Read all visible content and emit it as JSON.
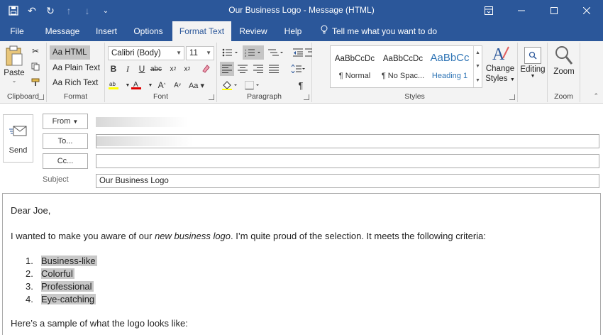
{
  "window": {
    "title": "Our Business Logo  -  Message (HTML)"
  },
  "tabs": [
    {
      "label": "File"
    },
    {
      "label": "Message"
    },
    {
      "label": "Insert"
    },
    {
      "label": "Options"
    },
    {
      "label": "Format Text"
    },
    {
      "label": "Review"
    },
    {
      "label": "Help"
    }
  ],
  "tell_me": "Tell me what you want to do",
  "ribbon": {
    "clipboard": {
      "paste": "Paste",
      "label": "Clipboard"
    },
    "format": {
      "html": "Aa HTML",
      "plain": "Aa Plain Text",
      "rich": "Aa Rich Text",
      "label": "Format"
    },
    "font": {
      "name": "Calibri (Body)",
      "size": "11",
      "label": "Font"
    },
    "paragraph": {
      "label": "Paragraph"
    },
    "styles": {
      "items": [
        {
          "sample": "AaBbCcDc",
          "name": "¶ Normal"
        },
        {
          "sample": "AaBbCcDc",
          "name": "¶ No Spac..."
        },
        {
          "sample": "AaBbCc",
          "name": "Heading 1"
        }
      ],
      "change_line1": "Change",
      "change_line2": "Styles",
      "label": "Styles"
    },
    "editing": "Editing",
    "zoom": {
      "button": "Zoom",
      "label": "Zoom"
    }
  },
  "compose": {
    "send": "Send",
    "from": "From",
    "to": "To...",
    "cc": "Cc...",
    "subject_label": "Subject",
    "subject_value": "Our Business Logo"
  },
  "message": {
    "greeting": "Dear Joe,",
    "intro_before": "I wanted to make you aware of our ",
    "intro_em": "new business logo",
    "intro_after": ". I’m quite proud of the selection. It meets the following criteria:",
    "criteria": [
      {
        "num": "1.",
        "text": "Business-like"
      },
      {
        "num": "2.",
        "text": "Colorful"
      },
      {
        "num": "3.",
        "text": "Professional"
      },
      {
        "num": "4.",
        "text": "Eye-catching"
      }
    ],
    "outro": "Here’s a sample of what the logo looks like:"
  }
}
